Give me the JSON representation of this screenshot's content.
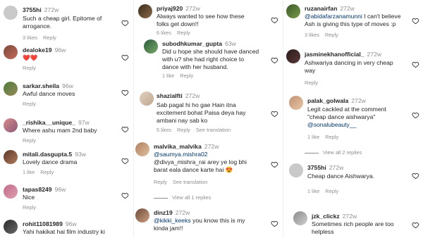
{
  "columns": [
    {
      "comments": [
        {
          "username": "3755hi",
          "time": "272w",
          "text": "Such a cheap girl. Epitome of\narrogance.",
          "likes": "3 likes",
          "reply": "Reply"
        },
        {
          "username": "dealoke19",
          "time": "96w",
          "text": "❤️❤️",
          "reply": "Reply"
        },
        {
          "username": "sarkar.sheila",
          "time": "96w",
          "text": "Awful dance moves",
          "reply": "Reply"
        },
        {
          "username": "_rishika__unique_",
          "time": "97w",
          "text": "Where ashu mam 2nd baby",
          "reply": "Reply"
        },
        {
          "username": "mitali.dasgupta.5",
          "time": "93w",
          "text": "Lovely dance drama",
          "likes": "1 like",
          "reply": "Reply"
        },
        {
          "username": "tapas8249",
          "time": "96w",
          "text": "Nice",
          "reply": "Reply"
        },
        {
          "username": "rohit11081989",
          "time": "96w",
          "text": "Yahi hakikat hai film industry ki"
        }
      ]
    },
    {
      "comments": [
        {
          "username": "priyaj920",
          "time": "272w",
          "text": "Always wanted to see how these\nfolks get down!!",
          "likes": "6 likes",
          "reply": "Reply"
        },
        {
          "username": "subodhkumar_gupta",
          "time": "63w",
          "text": "Did u hope she should have danced\nwith u? she had right choice to\ndance with her husband.",
          "likes": "1 like",
          "reply": "Reply"
        },
        {
          "username": "shazialfti",
          "time": "272w",
          "text": "Sab pagal hi ho gae Hain itna\nexcitement bohat Paisa deya hay\nambani nay sab ko",
          "likes": "5 likes",
          "reply": "Reply",
          "translate": "See translation"
        },
        {
          "username": "malvika_malvika",
          "time": "272w",
          "mention": "@saumya.mishra02",
          "text": "@divya_mishra_rai arey ye log bhi\nbarat eala dance karte hai 😍",
          "reply": "Reply",
          "translate": "See translation"
        },
        {
          "username": "dinz19",
          "time": "272w",
          "mention": "@kikki_keeks",
          "text": "you know this is my\nkinda jam!!"
        }
      ],
      "view_replies": "View all 1 replies"
    },
    {
      "comments": [
        {
          "username": "ruzanairfan",
          "time": "272w",
          "mention": "@abidafarzanamunni",
          "text": "I can't believe\nAsh is giving this type of moves :p",
          "likes": "3 likes",
          "reply": "Reply"
        },
        {
          "username": "jasminekhanofficial_",
          "time": "272w",
          "text": "Ashwariya dancing in very cheap\nway",
          "reply": "Reply"
        },
        {
          "username": "palak_golwala",
          "time": "272w",
          "text": "Legit cackled at the comment\n\"cheap dance aishwarya\"",
          "mention": "@sonalubeauty__",
          "likes": "1 like",
          "reply": "Reply"
        },
        {
          "username": "3755hi",
          "time": "272w",
          "text": "Cheap dance Aishwarya.",
          "likes": "1 like",
          "reply": "Reply"
        },
        {
          "username": "jzk_clickz",
          "time": "272w",
          "text": "Sometimes rich people are too\nhelpless"
        }
      ],
      "view_replies": "View all 2 replies"
    }
  ],
  "colors": {
    "text": "#262626",
    "muted": "#8e8e8e",
    "link": "#00376b",
    "heart_red": "#ed4956"
  },
  "icons": {
    "like": "heart-outline-icon",
    "emoji_heart": "red-heart-emoji"
  }
}
